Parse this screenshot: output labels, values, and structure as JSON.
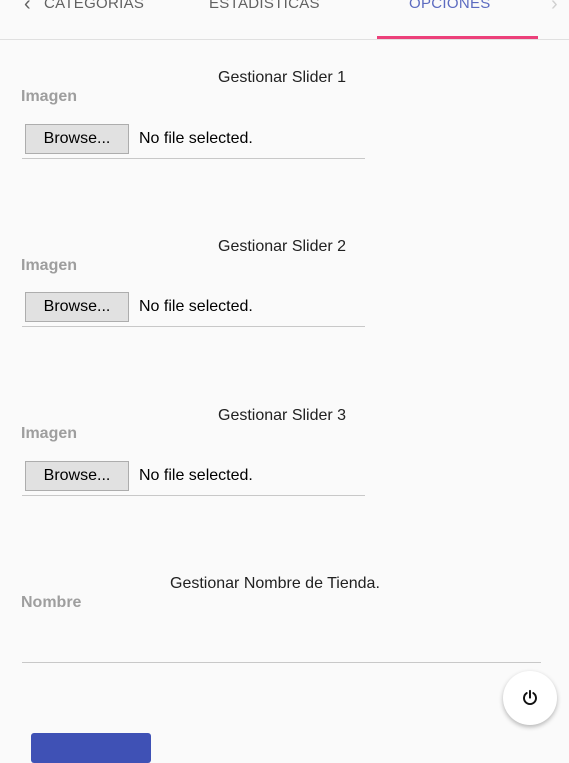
{
  "tabs": {
    "categorias": "CATEGORIAS",
    "estadisticas": "ESTADISTICAS",
    "opciones": "OPCIONES",
    "active": "opciones"
  },
  "sliders": [
    {
      "title": "Gestionar Slider 1",
      "field_label": "Imagen",
      "browse_label": "Browse...",
      "file_status": "No file selected."
    },
    {
      "title": "Gestionar Slider 2",
      "field_label": "Imagen",
      "browse_label": "Browse...",
      "file_status": "No file selected."
    },
    {
      "title": "Gestionar Slider 3",
      "field_label": "Imagen",
      "browse_label": "Browse...",
      "file_status": "No file selected."
    }
  ],
  "store_name": {
    "title": "Gestionar Nombre de Tienda.",
    "field_label": "Nombre",
    "value": ""
  },
  "icons": {
    "tab_prev": "chevron-left-icon",
    "tab_next": "chevron-right-icon",
    "power": "power-icon"
  },
  "colors": {
    "tab_indicator": "#ec407a",
    "active_tab_text": "#5c6bc0",
    "primary_button": "#3f51b5",
    "field_label": "#9e9e9e"
  }
}
